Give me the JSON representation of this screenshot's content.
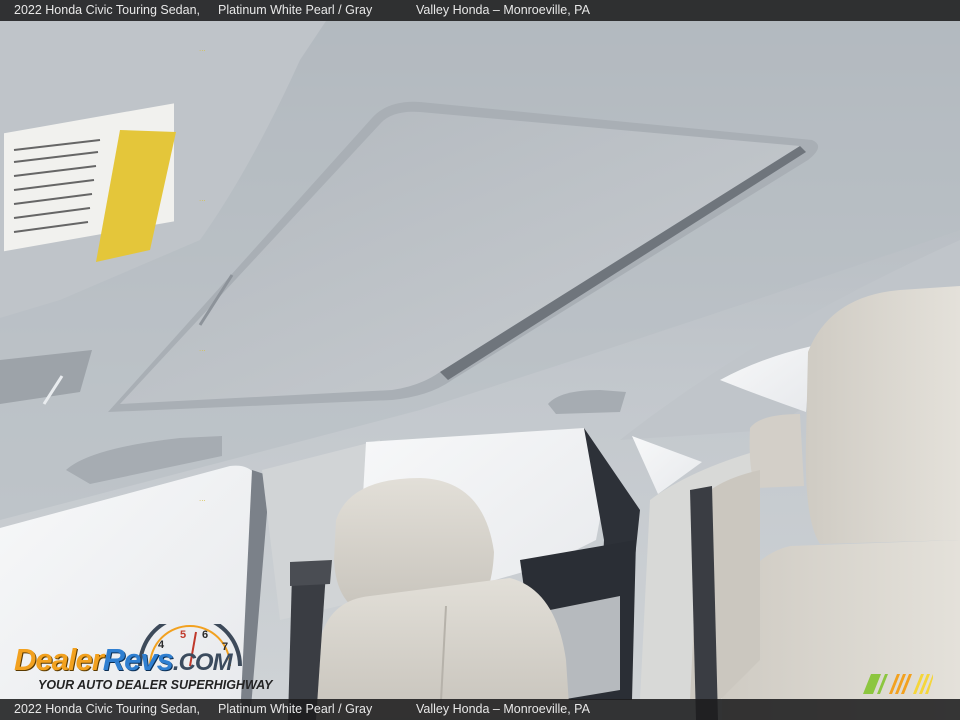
{
  "caption": {
    "vehicle": "2022 Honda Civic Touring Sedan,",
    "color": "Platinum White Pearl / Gray",
    "dealer": "Valley Honda – Monroeville, PA"
  },
  "watermark": {
    "brand_part_1": "Dealer",
    "brand_part_2": "Revs",
    "brand_part_3": ".COM",
    "tagline": "YOUR AUTO DEALER SUPERHIGHWAY",
    "gauge_digits": [
      "4",
      "5",
      "6",
      "7"
    ]
  },
  "colors": {
    "headliner": "#c9ced3",
    "headliner_shadow": "#8c939b",
    "window_glass": "#f3f4f6",
    "seat_leather": "#d7d4cd",
    "seatbelt": "#3a3d43",
    "brand_orange": "#f2a11f",
    "brand_blue": "#2f7fd1"
  },
  "photo": {
    "subject": "interior-sunroof-view",
    "icons": [
      "sunroof-panel",
      "sun-visor",
      "grab-handle",
      "headrest",
      "seatbelt",
      "door-glass"
    ]
  }
}
